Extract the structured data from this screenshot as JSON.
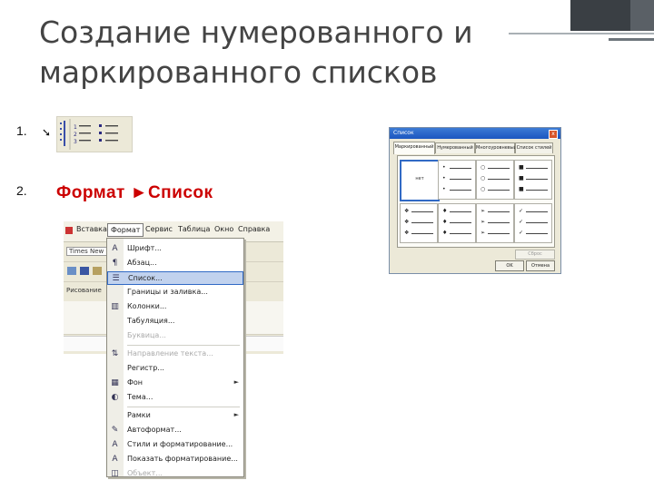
{
  "slide": {
    "title": "Создание нумерованного и маркированного списков",
    "item1_number": "1.",
    "item2_number": "2.",
    "item2_text": "Формат ►Список",
    "accent_color": "#cc0000"
  },
  "toolbar_icons": [
    "text-direction-icon",
    "numbered-list-icon",
    "bulleted-list-icon"
  ],
  "word_window": {
    "menu": [
      "Вставка",
      "Формат",
      "Сервис",
      "Таблица",
      "Окно",
      "Справка"
    ],
    "style_box": "Times New R",
    "toolbar_label": "Рисование",
    "format_menu": [
      {
        "label": "Шрифт...",
        "icon": "font-icon",
        "submenu": false,
        "disabled": false,
        "highlighted": false
      },
      {
        "label": "Абзац...",
        "icon": "paragraph-icon",
        "submenu": false,
        "disabled": false,
        "highlighted": false
      },
      {
        "label": "Список...",
        "icon": "list-icon",
        "submenu": false,
        "disabled": false,
        "highlighted": true
      },
      {
        "label": "Границы и заливка...",
        "icon": "",
        "submenu": false,
        "disabled": false,
        "highlighted": false
      },
      {
        "label": "Колонки...",
        "icon": "columns-icon",
        "submenu": false,
        "disabled": false,
        "highlighted": false
      },
      {
        "label": "Табуляция...",
        "icon": "",
        "submenu": false,
        "disabled": false,
        "highlighted": false
      },
      {
        "label": "Буквица...",
        "icon": "",
        "submenu": false,
        "disabled": true,
        "highlighted": false
      },
      {
        "label": "Направление текста...",
        "icon": "text-direction-icon",
        "submenu": false,
        "disabled": true,
        "highlighted": false
      },
      {
        "label": "Регистр...",
        "icon": "",
        "submenu": false,
        "disabled": false,
        "highlighted": false
      },
      {
        "label": "Фон",
        "icon": "background-icon",
        "submenu": true,
        "disabled": false,
        "highlighted": false
      },
      {
        "label": "Тема...",
        "icon": "theme-icon",
        "submenu": false,
        "disabled": false,
        "highlighted": false
      },
      {
        "label": "Рамки",
        "icon": "",
        "submenu": true,
        "disabled": false,
        "highlighted": false
      },
      {
        "label": "Автоформат...",
        "icon": "autoformat-icon",
        "submenu": false,
        "disabled": false,
        "highlighted": false
      },
      {
        "label": "Стили и форматирование...",
        "icon": "styles-icon",
        "submenu": false,
        "disabled": false,
        "highlighted": false
      },
      {
        "label": "Показать форматирование...",
        "icon": "reveal-format-icon",
        "submenu": false,
        "disabled": false,
        "highlighted": false
      },
      {
        "label": "Объект...",
        "icon": "object-icon",
        "submenu": false,
        "disabled": true,
        "highlighted": false
      }
    ],
    "submenu_arrow": "►"
  },
  "dialog": {
    "title": "Список",
    "close": "x",
    "tabs": [
      "Маркированный",
      "Нумерованный",
      "Многоуровневый",
      "Список стилей"
    ],
    "none_label": "нет",
    "markers": [
      "•",
      "○",
      "■",
      "❖",
      "➢",
      "✓",
      "♦"
    ],
    "ok": "OK",
    "cancel": "Отмена",
    "reset": "Сброс"
  }
}
